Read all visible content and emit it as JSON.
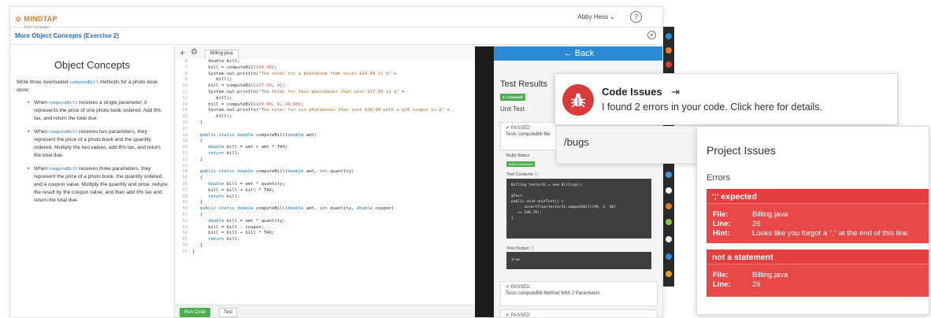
{
  "topbar": {
    "brand": "MINDTAP",
    "brand_sub": "from Cengage",
    "user": "Abby Hess ⌄",
    "help": "?"
  },
  "exercise": {
    "title": "More Object Concepts (Exercise 2)",
    "close": "×"
  },
  "instructions": {
    "title": "Object Concepts",
    "intro_a": "Write three overloaded ",
    "intro_code": "computeBill",
    "intro_b": " methods for a photo book store:",
    "items": [
      {
        "a": "When ",
        "code": "computeBill",
        "b": " receives a single parameter, it represents the price of one photo book ordered. Add 8% tax, and return the total due."
      },
      {
        "a": "When ",
        "code": "computeBill",
        "b": " receives two parameters, they represent the price of a photo book and the quantity ordered. Multiply the two values, add 8% tax, and return the total due."
      },
      {
        "a": "When ",
        "code": "computeBill",
        "b": " receives three parameters, they represent the price of a photo book, the quantity ordered, and a coupon value. Multiply the quantity and price, reduce the result by the coupon value, and then add 8% tax and return the total due."
      }
    ]
  },
  "editor": {
    "tab": "Billing.java",
    "run_label": "Run Code",
    "test_label": "Test"
  },
  "code_lines": [
    {
      "n": "6",
      "html": "      double bill;"
    },
    {
      "n": "7",
      "html": "      bill = computeBill(<span class='numlit'>24.99</span>);"
    },
    {
      "n": "8",
      "html": "      System.out.println(<span class='str'>\"The total for a photobook that costs $24.99 is $\"</span> +"
    },
    {
      "n": "9",
      "html": "         bill);"
    },
    {
      "n": "10",
      "html": "      bill = computeBill(<span class='numlit'>17.50</span>, <span class='numlit'>4</span>);"
    },
    {
      "n": "11",
      "html": "      System.out.println(<span class='str'>\"The total for four photobooks that cost $17.50 is $\"</span> +"
    },
    {
      "n": "12",
      "html": "         bill);"
    },
    {
      "n": "13",
      "html": "      bill = computeBill(<span class='numlit'>10.00</span>, <span class='numlit'>6</span>, <span class='numlit'>20.00</span>);"
    },
    {
      "n": "14",
      "html": "      System.out.println(<span class='str'>\"The total for six photobooks that cost $10.00 with a $20 coupon is $\"</span> +"
    },
    {
      "n": "15",
      "html": "         bill);"
    },
    {
      "n": "16",
      "html": "   }"
    },
    {
      "n": "17",
      "html": ""
    },
    {
      "n": "18",
      "html": "   <span class='kw'>public static double</span> computeBill(<span class='kw'>double</span> amt)"
    },
    {
      "n": "19",
      "html": "   {"
    },
    {
      "n": "20",
      "html": "      <span class='kw'>double</span> bill = amt + amt * TAX;"
    },
    {
      "n": "21",
      "html": "      <span class='kw'>return</span> bill;"
    },
    {
      "n": "22",
      "html": "   }"
    },
    {
      "n": "23",
      "html": ""
    },
    {
      "n": "24",
      "html": "   <span class='kw'>public static double</span> computeBill(<span class='kw'>double</span> amt, <span class='kw'>int</span> quantity)"
    },
    {
      "n": "25",
      "html": "   {"
    },
    {
      "n": "26",
      "html": "      <span class='kw'>double</span> bill = amt * quantity;"
    },
    {
      "n": "27",
      "html": "      bill = bill + bill * TAX;"
    },
    {
      "n": "28",
      "html": "      <span class='kw'>return</span> bill;"
    },
    {
      "n": "29",
      "html": "   }"
    },
    {
      "n": "30",
      "html": "   <span class='kw'>public static double</span> computeBill(<span class='kw'>double</span> amt, <span class='kw'>int</span> quantity, <span class='kw'>double</span> coupon)"
    },
    {
      "n": "31",
      "html": "   {"
    },
    {
      "n": "32",
      "html": "      <span class='kw'>double</span> bill = amt * quantity;"
    },
    {
      "n": "33",
      "html": "      bill = bill - coupon;"
    },
    {
      "n": "34",
      "html": "      bill = bill + bill * TAX;"
    },
    {
      "n": "35",
      "html": "      <span class='kw'>return</span> bill;"
    },
    {
      "n": "36",
      "html": "   }"
    },
    {
      "n": "37",
      "html": "}"
    }
  ],
  "results": {
    "back_label": "← Back",
    "title": "Test Results",
    "passed_badge": "3 / 3 passed",
    "unit_test": "Unit Test",
    "pass1_label": "PASSED:",
    "pass1_desc": "Tests computeBill Me",
    "build_status": "Build Status",
    "build_badge": "Build Succeeded",
    "test_contents": "Test Contents ⓘ",
    "code_block": "Billing tester31 = new Billing();\n\n@Test\npublic void unitTest() {\n      assertTrue(tester31.computeBill(99, 2, 30)\n   == 246.76);\n}",
    "test_output": "Test Output ⓘ",
    "out_block": "true",
    "pass2_label": "PASSED:",
    "pass2_desc": "Tests computeBill Method With 2 Parameters",
    "pass3_label": "PASSED:"
  },
  "code_issues": {
    "title": "Code Issues",
    "message": "I found 2 errors in your code. Click here for details."
  },
  "bugs_box": {
    "command": "/bugs"
  },
  "project_issues": {
    "title": "Project Issues",
    "errors_label": "Errors",
    "file_key": "File:",
    "line_key": "Line:",
    "hint_key": "Hint:",
    "items": [
      {
        "title": "';' expected",
        "file": "Billing.java",
        "line": "26",
        "hint": "Looks like you forgot a \";\" at the end of this line."
      },
      {
        "title": "not a statement",
        "file": "Billing.java",
        "line": "26"
      }
    ]
  },
  "colors": {
    "accent_blue": "#2a8ad4",
    "success_green": "#4cae4c",
    "error_red": "#e84848",
    "brand_orange": "#e07a2a"
  }
}
